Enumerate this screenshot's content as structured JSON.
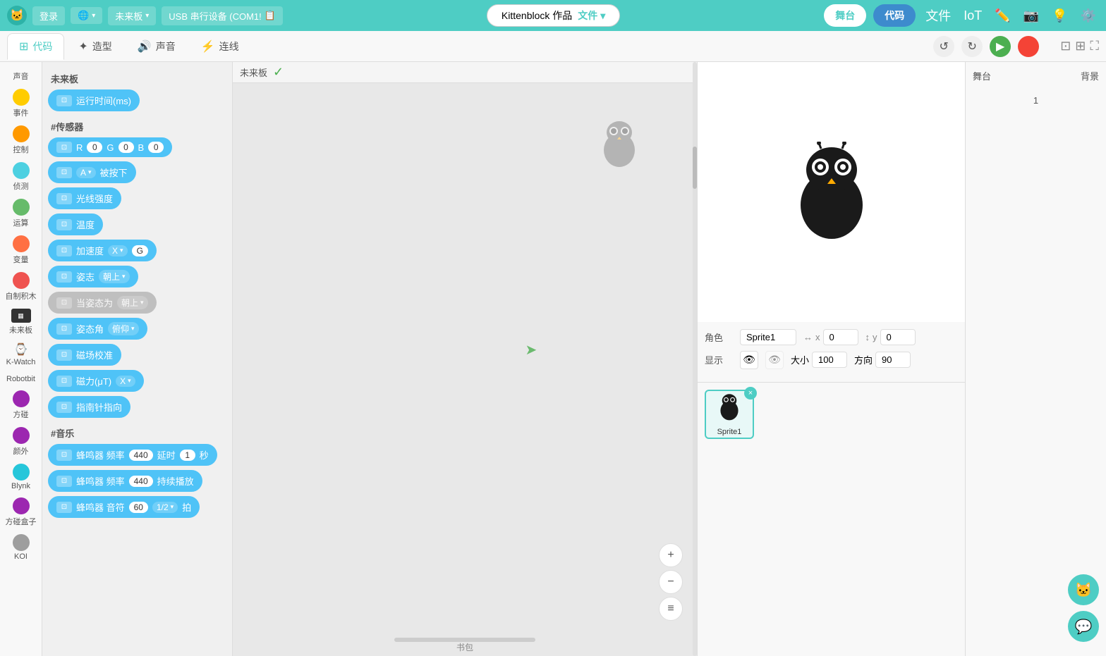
{
  "topbar": {
    "login": "登录",
    "board": "未来板",
    "device": "USB 串行设备 (COM1!",
    "project_title": "Kittenblock 作品",
    "file_label": "文件",
    "stage_label": "舞台",
    "code_label": "代码",
    "menu_wenjianjia": "文件",
    "menu_IoT": "IoT",
    "icon_edit": "✏",
    "icon_camera": "📷",
    "icon_light": "💡",
    "icon_settings": "⚙"
  },
  "tabs": {
    "code": "代码",
    "shape": "造型",
    "sound": "声音",
    "connect": "连线"
  },
  "controls": {
    "undo": "↺",
    "redo": "↻",
    "green_flag": "▶",
    "red_stop": "●"
  },
  "sidebar": {
    "categories": [
      {
        "id": "sound",
        "label": "声音",
        "color": "#fff",
        "dot": false
      },
      {
        "id": "event",
        "label": "事件",
        "color": "#ffcc00",
        "dot": true
      },
      {
        "id": "control",
        "label": "控制",
        "color": "#ff9900",
        "dot": true
      },
      {
        "id": "detect",
        "label": "侦测",
        "color": "#4dd0e1",
        "dot": true
      },
      {
        "id": "compute",
        "label": "运算",
        "color": "#66bb6a",
        "dot": true
      },
      {
        "id": "variable",
        "label": "变量",
        "color": "#ff7043",
        "dot": true
      },
      {
        "id": "custom",
        "label": "自制积木",
        "color": "#ef5350",
        "dot": true
      },
      {
        "id": "future-board",
        "label": "未来板",
        "color": "#424242",
        "dot": false,
        "icon": true
      },
      {
        "id": "k-watch",
        "label": "K-Watch",
        "color": "#888",
        "dot": false
      },
      {
        "id": "robotbit",
        "label": "Robotbit",
        "color": "#888",
        "dot": false
      },
      {
        "id": "cube",
        "label": "方碰",
        "color": "#9c27b0",
        "dot": true
      },
      {
        "id": "outdoor",
        "label": "颜外",
        "color": "#9c27b0",
        "dot": true
      },
      {
        "id": "blynk",
        "label": "Blynk",
        "color": "#26c6da",
        "dot": true
      },
      {
        "id": "cube2",
        "label": "方碰盒子",
        "color": "#9c27b0",
        "dot": true
      },
      {
        "id": "koi",
        "label": "KOI",
        "color": "#9e9e9e",
        "dot": true
      }
    ]
  },
  "blocks_panel": {
    "section1": "未来板",
    "section2": "#传感器",
    "section3": "#音乐",
    "blocks": [
      {
        "id": "runtime",
        "label": "运行时间(ms)",
        "type": "fn"
      },
      {
        "id": "rgb",
        "label": "R",
        "type": "rgb",
        "vals": [
          "R",
          "0",
          "G",
          "0",
          "B",
          "0"
        ]
      },
      {
        "id": "btn-pressed",
        "label": "被按下",
        "type": "btn",
        "btn": "A"
      },
      {
        "id": "light",
        "label": "光线强度",
        "type": "fn"
      },
      {
        "id": "temp",
        "label": "温度",
        "type": "fn"
      },
      {
        "id": "accel",
        "label": "加速度",
        "type": "accel",
        "axis": "X",
        "val": "G"
      },
      {
        "id": "posture",
        "label": "姿志",
        "type": "posture",
        "val": "朝上"
      },
      {
        "id": "posture-angle-active",
        "label": "当姿态为",
        "type": "posture-active",
        "val": "朝上"
      },
      {
        "id": "posture-angle",
        "label": "姿态角",
        "type": "posture-angle",
        "val": "俯仰"
      },
      {
        "id": "magcal",
        "label": "磁场校准",
        "type": "fn"
      },
      {
        "id": "mag",
        "label": "磁力(μT)",
        "type": "mag",
        "axis": "X"
      },
      {
        "id": "compass",
        "label": "指南针指向",
        "type": "fn"
      },
      {
        "id": "buzzer-freq",
        "label": "蜂鸣器 频率",
        "type": "buzzer",
        "freq": "440",
        "delay_label": "延时",
        "delay_val": "1",
        "unit": "秒"
      },
      {
        "id": "buzzer-freq2",
        "label": "蜂鸣器 频率",
        "type": "buzzer2",
        "freq": "440",
        "action": "持续播放"
      },
      {
        "id": "buzzer-note",
        "label": "蜂鸣器 音符",
        "type": "buzzer3",
        "note": "60",
        "beat": "1/2",
        "unit": "拍"
      }
    ]
  },
  "canvas": {
    "board_name": "未来板",
    "check": "✓",
    "footer": "书包"
  },
  "stage": {
    "sprite_label": "角色",
    "sprite_name": "Sprite1",
    "x_label": "x",
    "x_val": "0",
    "y_label": "y",
    "y_val": "0",
    "display_label": "显示",
    "size_label": "大小",
    "size_val": "100",
    "direction_label": "方向",
    "direction_val": "90",
    "sprite1_name": "Sprite1",
    "stage_label": "舞台",
    "backdrop_label": "背景",
    "backdrop_count": "1"
  }
}
